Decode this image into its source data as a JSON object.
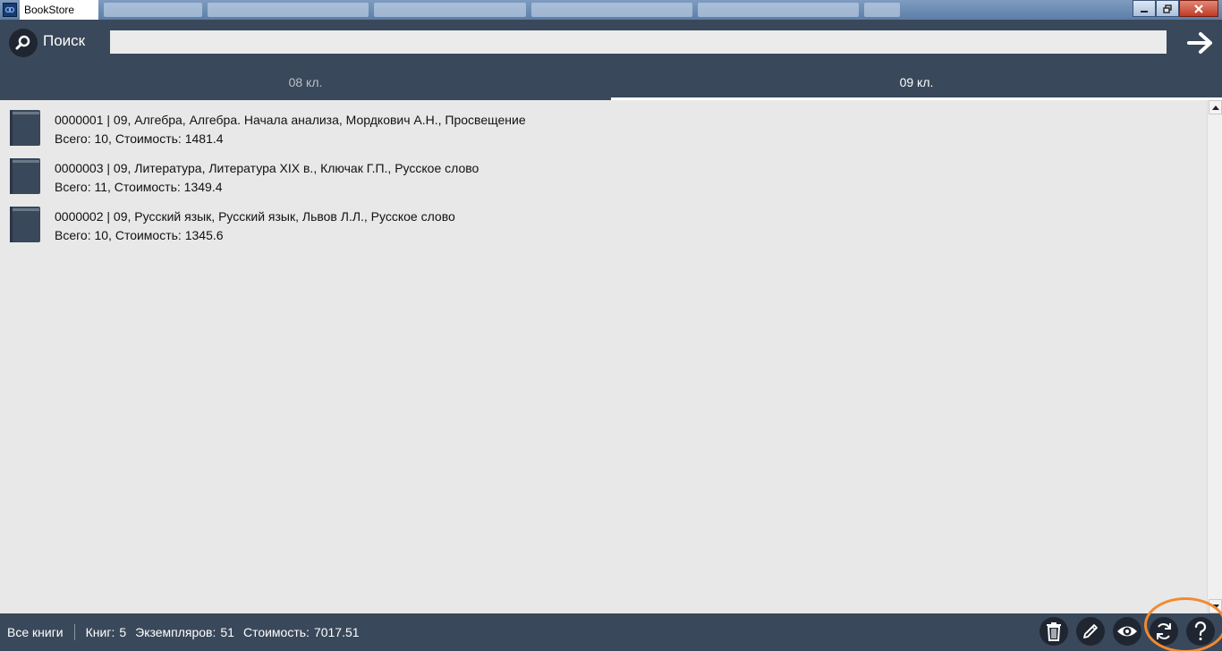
{
  "window": {
    "title": "BookStore"
  },
  "search": {
    "label": "Поиск",
    "value": "",
    "placeholder": ""
  },
  "tabs": [
    {
      "label": "08 кл.",
      "active": false
    },
    {
      "label": "09 кл.",
      "active": true
    }
  ],
  "books": [
    {
      "line1": "0000001 | 09, Алгебра, Алгебра. Начала анализа, Мордкович А.Н., Просвещение",
      "line2": "Всего: 10, Стоимость: 1481.4"
    },
    {
      "line1": "0000003 | 09, Литература, Литература XIX в., Ключак Г.П., Русское слово",
      "line2": "Всего: 11, Стоимость: 1349.4"
    },
    {
      "line1": "0000002 | 09, Русский язык, Русский язык, Львов Л.Л., Русское слово",
      "line2": "Всего: 10, Стоимость: 1345.6"
    }
  ],
  "footer": {
    "all_books": "Все книги",
    "books_label": "Книг:",
    "books_count": "5",
    "copies_label": "Экземпляров:",
    "copies_count": "51",
    "cost_label": "Стоимость:",
    "cost_value": "7017.51"
  },
  "actions": [
    {
      "icon": "trash-icon"
    },
    {
      "icon": "pencil-icon"
    },
    {
      "icon": "eye-icon"
    },
    {
      "icon": "refresh-icon"
    },
    {
      "icon": "help-icon"
    }
  ],
  "colors": {
    "header_bg": "#39485a",
    "content_bg": "#e8e8e8",
    "highlight": "#f28a30"
  }
}
